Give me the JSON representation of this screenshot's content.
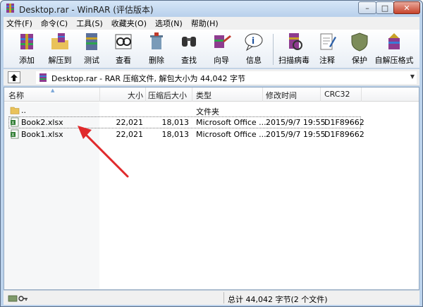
{
  "window": {
    "title": "Desktop.rar - WinRAR (评估版本)"
  },
  "window_buttons": {
    "minimize": "–",
    "maximize": "□",
    "close": "✕"
  },
  "menu": [
    "文件(F)",
    "命令(C)",
    "工具(S)",
    "收藏夹(O)",
    "选项(N)",
    "帮助(H)"
  ],
  "toolbar": [
    {
      "label": "添加",
      "icon": "add-icon"
    },
    {
      "label": "解压到",
      "icon": "extract-to-icon"
    },
    {
      "label": "测试",
      "icon": "test-icon"
    },
    {
      "label": "查看",
      "icon": "view-icon"
    },
    {
      "label": "删除",
      "icon": "delete-icon"
    },
    {
      "label": "查找",
      "icon": "find-icon"
    },
    {
      "label": "向导",
      "icon": "wizard-icon"
    },
    {
      "label": "信息",
      "icon": "info-icon"
    },
    {
      "label": "扫描病毒",
      "icon": "virus-scan-icon"
    },
    {
      "label": "注释",
      "icon": "comment-icon"
    },
    {
      "label": "保护",
      "icon": "protect-icon"
    },
    {
      "label": "自解压格式",
      "icon": "sfx-icon"
    }
  ],
  "address": {
    "text": "Desktop.rar - RAR 压缩文件, 解包大小为 44,042 字节"
  },
  "columns": {
    "name": "名称",
    "size": "大小",
    "packed": "压缩后大小",
    "type": "类型",
    "modified": "修改时间",
    "crc": "CRC32"
  },
  "rows": [
    {
      "name": "..",
      "size": "",
      "packed": "",
      "type": "文件夹",
      "modified": "",
      "crc": "",
      "icon": "folder-icon"
    },
    {
      "name": "Book2.xlsx",
      "size": "22,021",
      "packed": "18,013",
      "type": "Microsoft Office ...",
      "modified": "2015/9/7 19:55",
      "crc": "D1F89662",
      "icon": "excel-file-icon"
    },
    {
      "name": "Book1.xlsx",
      "size": "22,021",
      "packed": "18,013",
      "type": "Microsoft Office ...",
      "modified": "2015/9/7 19:55",
      "crc": "D1F89662",
      "icon": "excel-file-icon"
    }
  ],
  "status": {
    "summary": "总计 44,042 字节(2 个文件)"
  },
  "colors": {
    "annotation_arrow": "#e0292b",
    "titlebar": "#c4d9f1"
  }
}
